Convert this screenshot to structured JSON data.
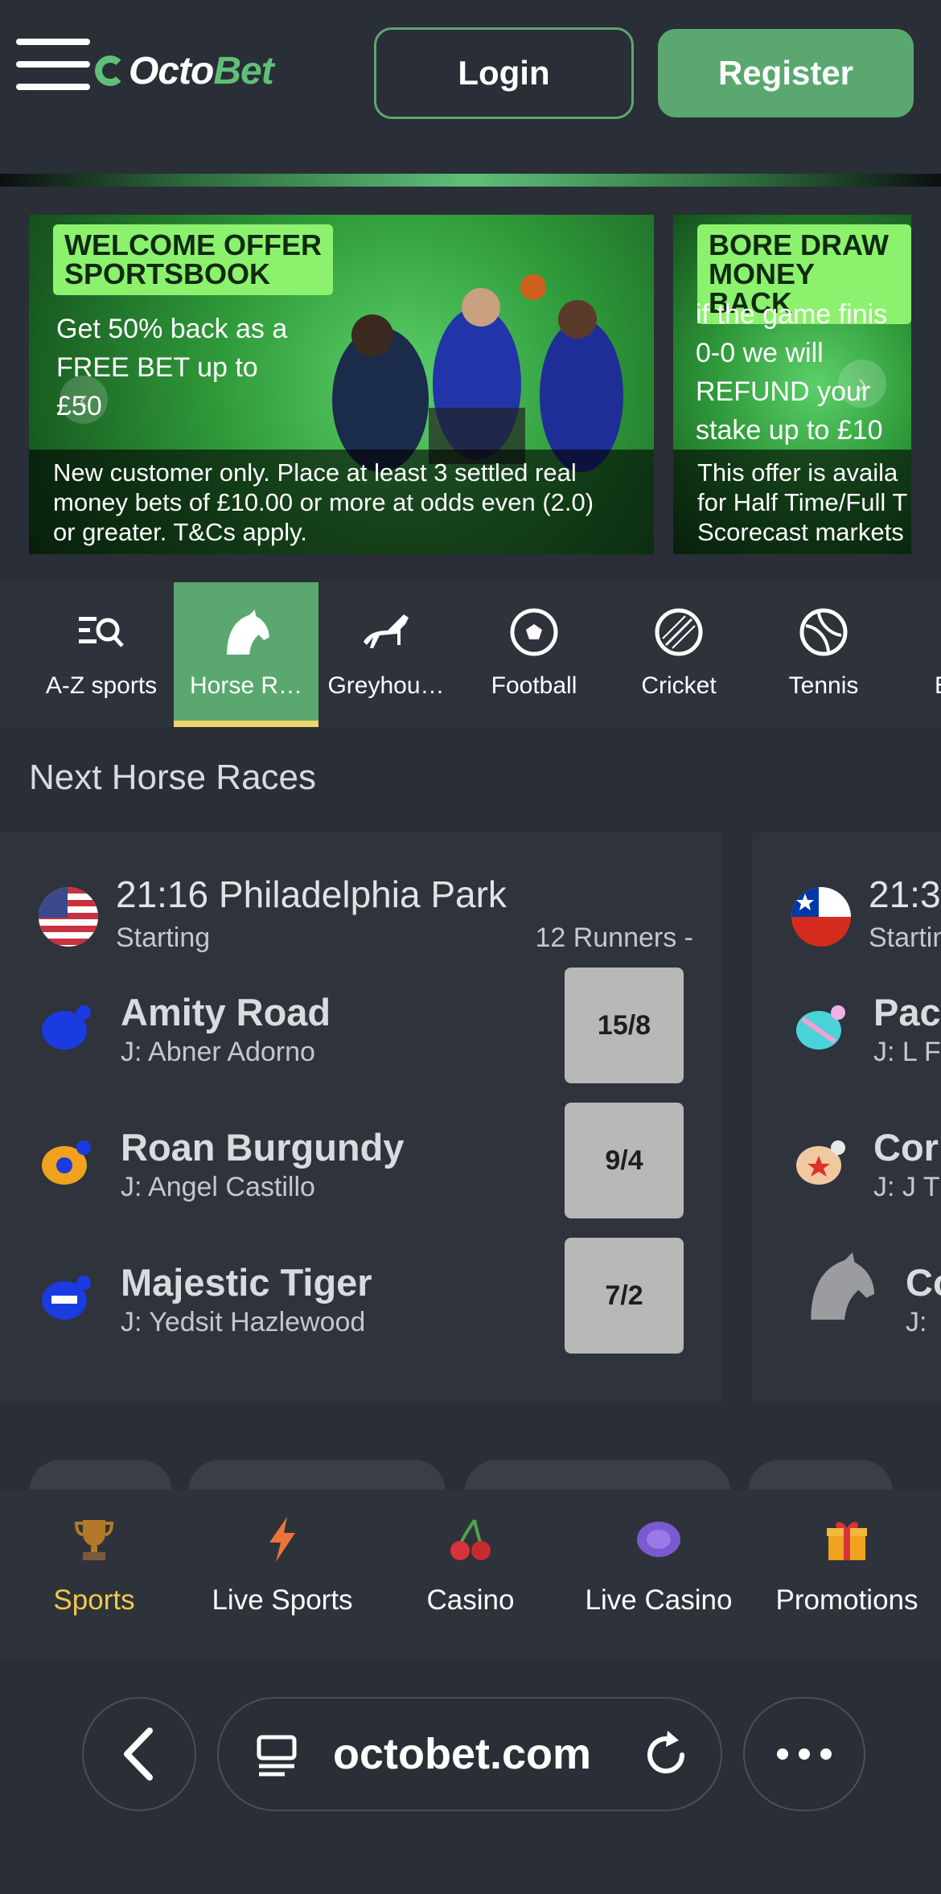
{
  "header": {
    "logo_a": "Octo",
    "logo_b": "Bet",
    "login_label": "Login",
    "register_label": "Register"
  },
  "promos": [
    {
      "tag_line1": "WELCOME OFFER",
      "tag_line2": "SPORTSBOOK",
      "body_lines": [
        "Get 50% back as a",
        "FREE BET up to",
        "£50"
      ],
      "caption_lines": [
        "New customer only. Place at least 3 settled real",
        "money bets of £10.00 or more at odds even (2.0)",
        "or greater. T&Cs apply."
      ]
    },
    {
      "tag_line1": "BORE DRAW",
      "tag_line2": "MONEY BACK",
      "body_lines": [
        "if the game finis",
        "0-0 we will",
        "REFUND your",
        "stake up to £10"
      ],
      "caption_lines": [
        "This offer is availa",
        "for Half Time/Full T",
        "Scorecast markets"
      ]
    }
  ],
  "sports_nav": [
    {
      "label": "A-Z sports",
      "icon": "az-search-icon"
    },
    {
      "label": "Horse R…",
      "icon": "horse-head-icon",
      "active": true
    },
    {
      "label": "Greyhou…",
      "icon": "greyhound-icon"
    },
    {
      "label": "Football",
      "icon": "football-icon"
    },
    {
      "label": "Cricket",
      "icon": "cricket-ball-icon"
    },
    {
      "label": "Tennis",
      "icon": "tennis-ball-icon"
    },
    {
      "label": "E",
      "icon": "more-sport-icon"
    }
  ],
  "next_races": {
    "title": "Next Horse Races",
    "cards": [
      {
        "title": "21:16 Philadelphia Park",
        "status": "Starting",
        "runners_count": "12 Runners  -",
        "flag": "us-flag",
        "runners": [
          {
            "name": "Amity Road",
            "jockey": "J: Abner Adorno",
            "odds": "15/8"
          },
          {
            "name": "Roan Burgundy",
            "jockey": "J: Angel Castillo",
            "odds": "9/4"
          },
          {
            "name": "Majestic Tiger",
            "jockey": "J: Yedsit Hazlewood",
            "odds": "7/2"
          }
        ]
      },
      {
        "title": "21:3",
        "status": "Startin",
        "flag": "cl-flag",
        "runners": [
          {
            "name": "Pac",
            "jockey": "J: L F"
          },
          {
            "name": "Cor",
            "jockey": "J: J T"
          },
          {
            "name": "Co",
            "jockey": "J: "
          }
        ]
      }
    ]
  },
  "tabbar": [
    {
      "label": "Sports",
      "icon": "trophy-icon",
      "active": true
    },
    {
      "label": "Live Sports",
      "icon": "lightning-icon"
    },
    {
      "label": "Casino",
      "icon": "cherries-icon"
    },
    {
      "label": "Live Casino",
      "icon": "chip-icon"
    },
    {
      "label": "Promotions",
      "icon": "gift-icon"
    }
  ],
  "browser": {
    "url": "octobet.com"
  },
  "colors": {
    "brand_green": "#5aa86f",
    "active_yellow": "#f2c94c",
    "bg": "#2a2e36"
  }
}
